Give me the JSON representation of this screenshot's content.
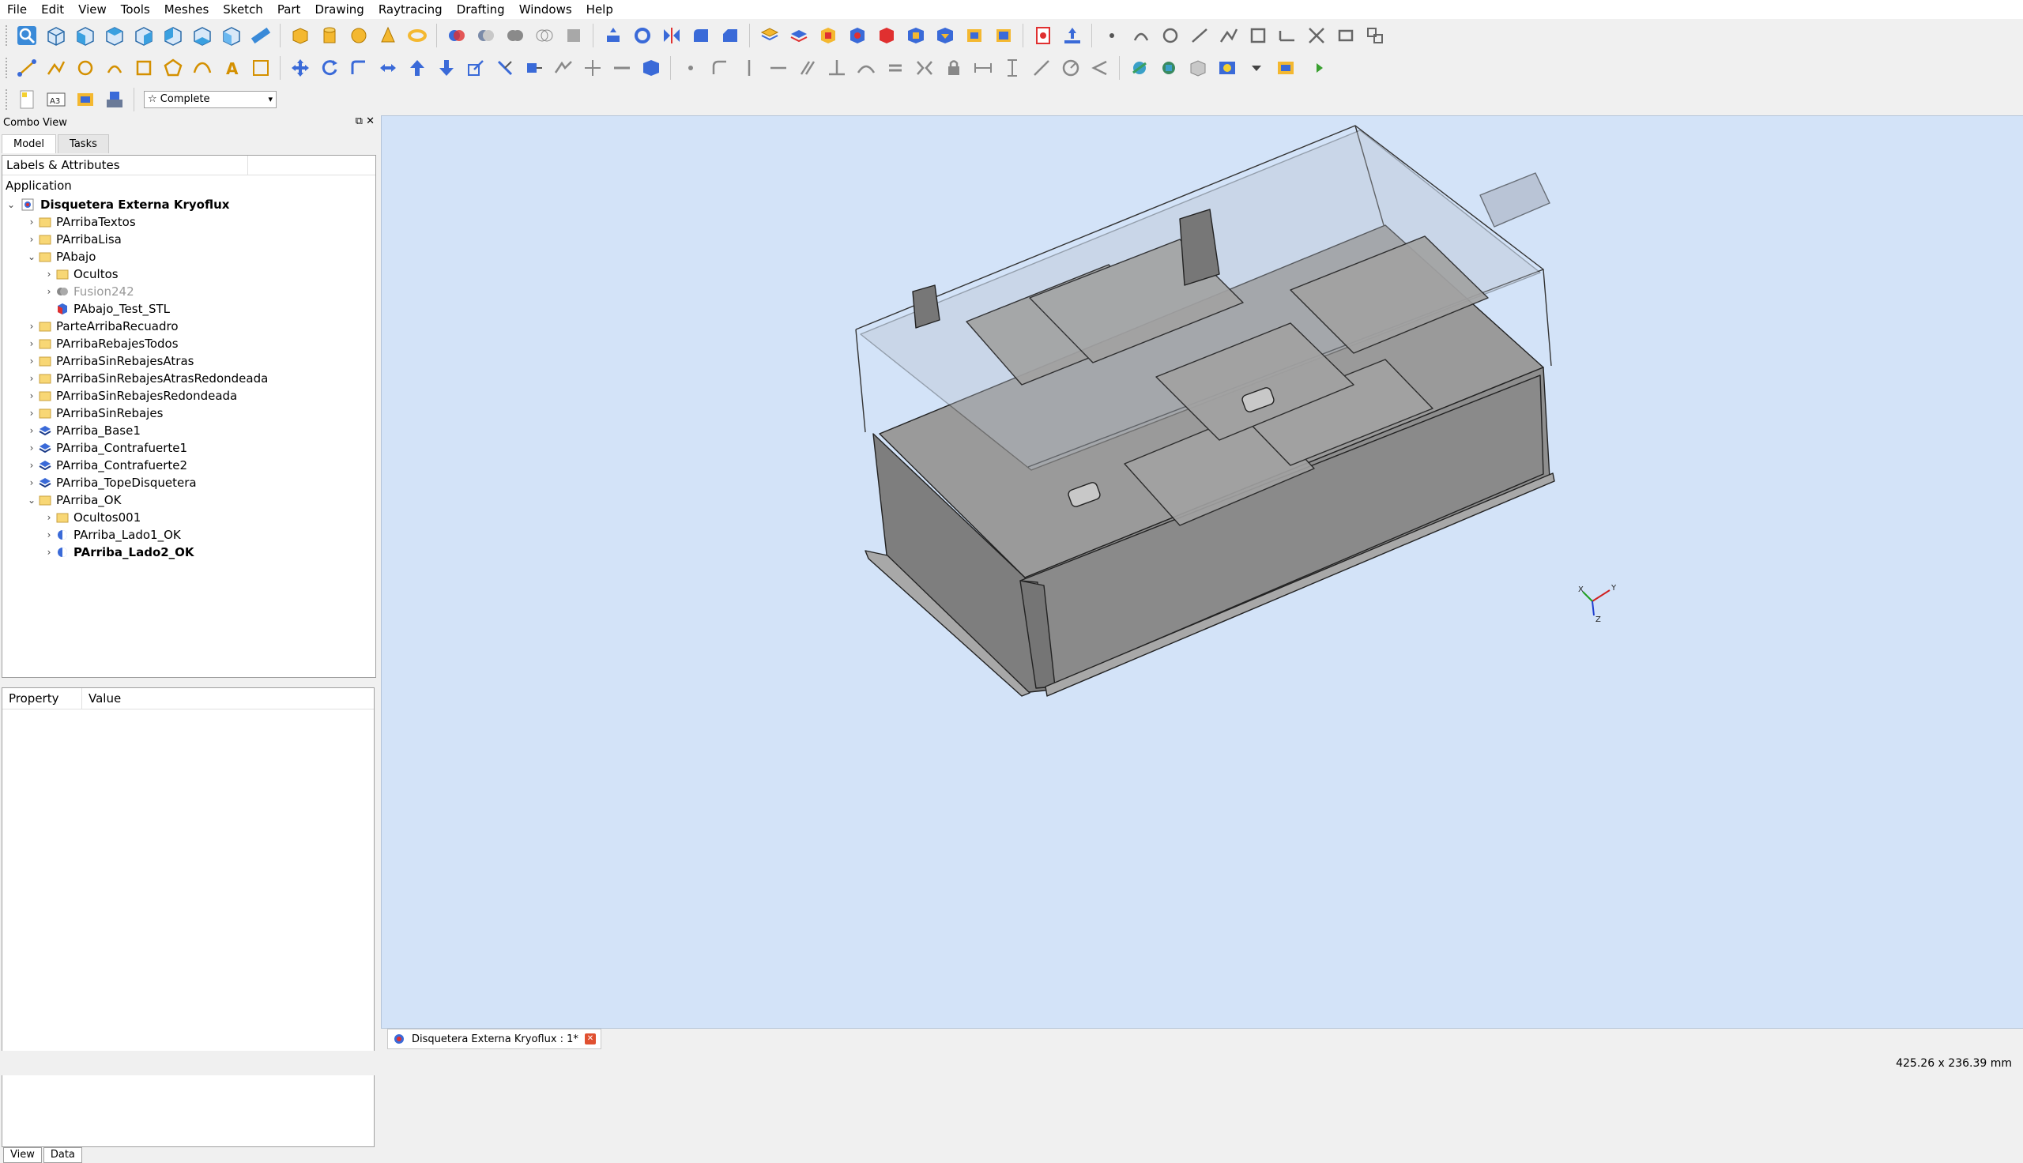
{
  "menus": [
    "File",
    "Edit",
    "View",
    "Tools",
    "Meshes",
    "Sketch",
    "Part",
    "Drawing",
    "Raytracing",
    "Drafting",
    "Windows",
    "Help"
  ],
  "workbench": {
    "selected": "Complete"
  },
  "combo_view": {
    "title": "Combo View",
    "tabs": [
      "Model",
      "Tasks"
    ],
    "header": "Labels & Attributes",
    "application": "Application",
    "document": "Disquetera Externa Kryoflux",
    "tree": [
      {
        "label": "PArribaTextos",
        "icon": "folder",
        "depth": 1,
        "arrow": "›"
      },
      {
        "label": "PArribaLisa",
        "icon": "folder",
        "depth": 1,
        "arrow": "›"
      },
      {
        "label": "PAbajo",
        "icon": "folder",
        "depth": 1,
        "arrow": "⌄"
      },
      {
        "label": "Ocultos",
        "icon": "folder",
        "depth": 2,
        "arrow": "›"
      },
      {
        "label": "Fusion242",
        "icon": "fusion",
        "depth": 2,
        "arrow": "›",
        "style": "grey"
      },
      {
        "label": "PAbajo_Test_STL",
        "icon": "mesh",
        "depth": 2,
        "arrow": ""
      },
      {
        "label": "ParteArribaRecuadro",
        "icon": "folder",
        "depth": 1,
        "arrow": "›"
      },
      {
        "label": "PArribaRebajesTodos",
        "icon": "folder",
        "depth": 1,
        "arrow": "›"
      },
      {
        "label": "PArribaSinRebajesAtras",
        "icon": "folder",
        "depth": 1,
        "arrow": "›"
      },
      {
        "label": "PArribaSinRebajesAtrasRedondeada",
        "icon": "folder",
        "depth": 1,
        "arrow": "›"
      },
      {
        "label": "PArribaSinRebajesRedondeada",
        "icon": "folder",
        "depth": 1,
        "arrow": "›"
      },
      {
        "label": "PArribaSinRebajes",
        "icon": "folder",
        "depth": 1,
        "arrow": "›"
      },
      {
        "label": "PArriba_Base1",
        "icon": "extrude",
        "depth": 1,
        "arrow": "›"
      },
      {
        "label": "PArriba_Contrafuerte1",
        "icon": "extrude",
        "depth": 1,
        "arrow": "›"
      },
      {
        "label": "PArriba_Contrafuerte2",
        "icon": "extrude",
        "depth": 1,
        "arrow": "›"
      },
      {
        "label": "PArriba_TopeDisquetera",
        "icon": "extrude",
        "depth": 1,
        "arrow": "›"
      },
      {
        "label": "PArriba_OK",
        "icon": "folder",
        "depth": 1,
        "arrow": "⌄"
      },
      {
        "label": "Ocultos001",
        "icon": "folder",
        "depth": 2,
        "arrow": "›"
      },
      {
        "label": "PArriba_Lado1_OK",
        "icon": "cut",
        "depth": 2,
        "arrow": "›"
      },
      {
        "label": "PArriba_Lado2_OK",
        "icon": "cut",
        "depth": 2,
        "arrow": "›",
        "style": "bold"
      }
    ],
    "property_header": {
      "property": "Property",
      "value": "Value"
    },
    "bottom_tabs": [
      "View",
      "Data"
    ]
  },
  "document_tab": "Disquetera Externa Kryoflux : 1*",
  "status": {
    "dimensions": "425.26 x 236.39 mm"
  },
  "axis": {
    "x": "X",
    "y": "Y",
    "z": "Z"
  },
  "colors": {
    "viewport_bg": "#d3e3f8",
    "model_fill": "#8c8c8c",
    "selection_bold": "#000000"
  }
}
